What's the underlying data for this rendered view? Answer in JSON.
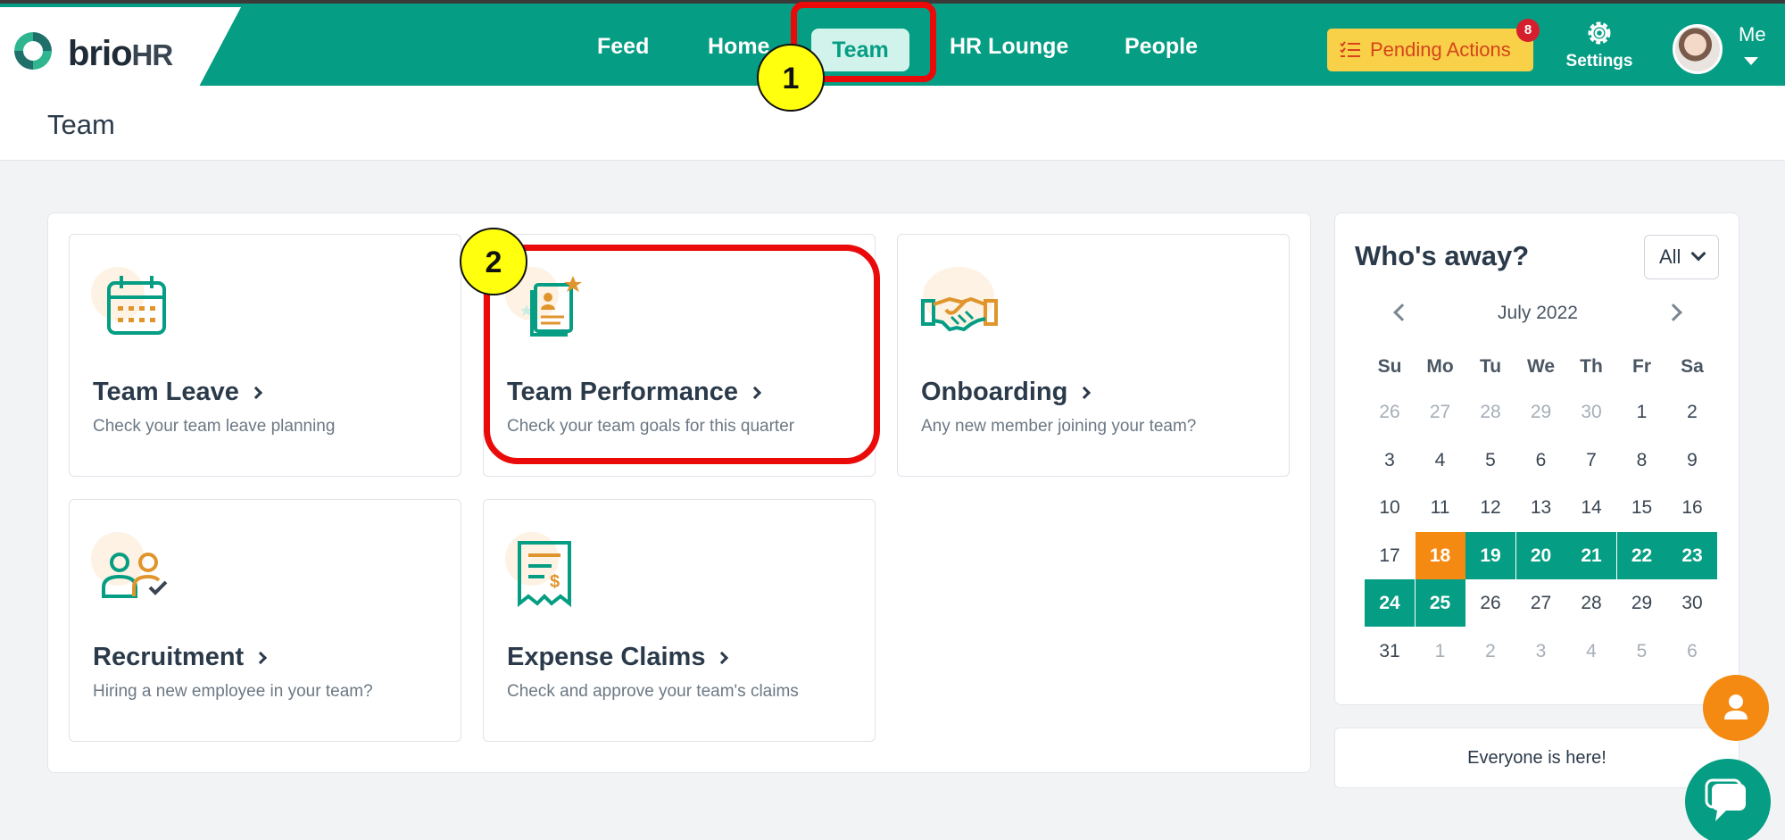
{
  "app": {
    "logo": "brioHR",
    "brand_color": "#059d83"
  },
  "nav": {
    "items": [
      {
        "label": "Feed"
      },
      {
        "label": "Home"
      },
      {
        "label": "Team",
        "active": true
      },
      {
        "label": "HR Lounge"
      },
      {
        "label": "People"
      }
    ],
    "pending_actions": {
      "label": "Pending Actions",
      "badge": "8",
      "icon": "checklist-icon"
    },
    "settings": {
      "label": "Settings",
      "icon": "gear-icon"
    },
    "user": {
      "label": "Me",
      "icon": "avatar"
    }
  },
  "page": {
    "title": "Team"
  },
  "cards": [
    {
      "title": "Team Leave",
      "desc": "Check your team leave planning",
      "icon": "calendar-icon"
    },
    {
      "title": "Team Performance",
      "desc": "Check your team goals for this quarter",
      "icon": "performance-icon"
    },
    {
      "title": "Onboarding",
      "desc": "Any new member joining your team?",
      "icon": "handshake-icon"
    },
    {
      "title": "Recruitment",
      "desc": "Hiring a new employee in your team?",
      "icon": "recruitment-icon"
    },
    {
      "title": "Expense Claims",
      "desc": "Check and approve your team's claims",
      "icon": "receipt-icon"
    }
  ],
  "whos_away": {
    "title": "Who's away?",
    "filter": "All",
    "month": "July 2022",
    "weekdays": [
      "Su",
      "Mo",
      "Tu",
      "We",
      "Th",
      "Fr",
      "Sa"
    ],
    "days": [
      [
        "26",
        "27",
        "28",
        "29",
        "30",
        "1",
        "2"
      ],
      [
        "3",
        "4",
        "5",
        "6",
        "7",
        "8",
        "9"
      ],
      [
        "10",
        "11",
        "12",
        "13",
        "14",
        "15",
        "16"
      ],
      [
        "17",
        "18",
        "19",
        "20",
        "21",
        "22",
        "23"
      ],
      [
        "24",
        "25",
        "26",
        "27",
        "28",
        "29",
        "30"
      ],
      [
        "31",
        "1",
        "2",
        "3",
        "4",
        "5",
        "6"
      ]
    ],
    "status": "Everyone is here!"
  },
  "annotations": [
    {
      "label": "1"
    },
    {
      "label": "2"
    }
  ]
}
